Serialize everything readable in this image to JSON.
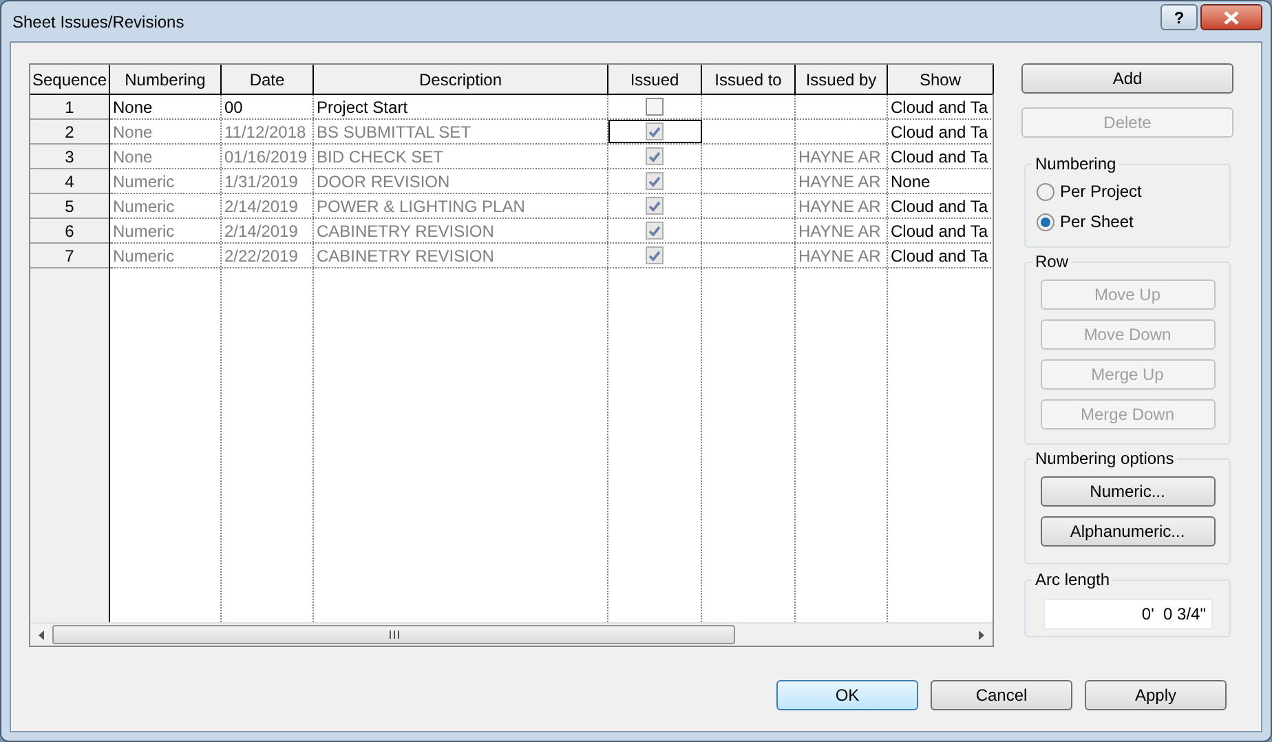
{
  "window": {
    "title": "Sheet Issues/Revisions",
    "help": "?"
  },
  "table": {
    "columns": [
      "Sequence",
      "Numbering",
      "Date",
      "Description",
      "Issued",
      "Issued to",
      "Issued by",
      "Show"
    ],
    "rows": [
      {
        "sequence": "1",
        "numbering": "None",
        "date": "00",
        "description": "Project Start",
        "issued": false,
        "issued_to": "",
        "issued_by": "",
        "show": "Cloud and Ta",
        "locked": false,
        "focused": false
      },
      {
        "sequence": "2",
        "numbering": "None",
        "date": "11/12/2018",
        "description": "BS SUBMITTAL SET",
        "issued": true,
        "issued_to": "",
        "issued_by": "",
        "show": "Cloud and Ta",
        "locked": true,
        "focused": true
      },
      {
        "sequence": "3",
        "numbering": "None",
        "date": "01/16/2019",
        "description": "BID CHECK SET",
        "issued": true,
        "issued_to": "",
        "issued_by": "HAYNE AR",
        "show": "Cloud and Ta",
        "locked": true,
        "focused": false
      },
      {
        "sequence": "4",
        "numbering": "Numeric",
        "date": "1/31/2019",
        "description": "DOOR REVISION",
        "issued": true,
        "issued_to": "",
        "issued_by": "HAYNE AR",
        "show": "None",
        "locked": true,
        "focused": false
      },
      {
        "sequence": "5",
        "numbering": "Numeric",
        "date": "2/14/2019",
        "description": "POWER & LIGHTING PLAN",
        "issued": true,
        "issued_to": "",
        "issued_by": "HAYNE AR",
        "show": "Cloud and Ta",
        "locked": true,
        "focused": false
      },
      {
        "sequence": "6",
        "numbering": "Numeric",
        "date": "2/14/2019",
        "description": "CABINETRY REVISION",
        "issued": true,
        "issued_to": "",
        "issued_by": "HAYNE AR",
        "show": "Cloud and Ta",
        "locked": true,
        "focused": false
      },
      {
        "sequence": "7",
        "numbering": "Numeric",
        "date": "2/22/2019",
        "description": "CABINETRY REVISION",
        "issued": true,
        "issued_to": "",
        "issued_by": "HAYNE AR",
        "show": "Cloud and Ta",
        "locked": true,
        "focused": false
      }
    ]
  },
  "actions": [
    {
      "label": "Add",
      "disabled": false
    },
    {
      "label": "Delete",
      "disabled": true
    }
  ],
  "numbering": {
    "title": "Numbering",
    "options": [
      {
        "label": "Per Project",
        "selected": false
      },
      {
        "label": "Per Sheet",
        "selected": true
      }
    ]
  },
  "row": {
    "title": "Row",
    "buttons": [
      {
        "label": "Move Up",
        "disabled": true
      },
      {
        "label": "Move Down",
        "disabled": true
      },
      {
        "label": "Merge Up",
        "disabled": true
      },
      {
        "label": "Merge Down",
        "disabled": true
      }
    ]
  },
  "numbering_options": {
    "title": "Numbering options",
    "buttons": [
      {
        "label": "Numeric...",
        "disabled": false
      },
      {
        "label": "Alphanumeric...",
        "disabled": false
      }
    ]
  },
  "arc_length": {
    "title": "Arc length",
    "value": "0'  0 3/4\""
  },
  "footer": [
    {
      "label": "OK",
      "default": true
    },
    {
      "label": "Cancel",
      "default": false
    },
    {
      "label": "Apply",
      "default": false
    }
  ]
}
